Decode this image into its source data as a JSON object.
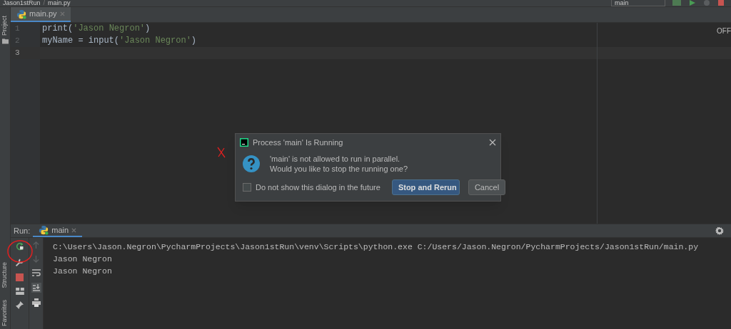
{
  "breadcrumb": {
    "items": [
      "Jason1stRun",
      "main.py"
    ],
    "separator": "/"
  },
  "run_config": {
    "label": "main"
  },
  "left_strip": {
    "top": [
      "Project"
    ],
    "bottom": [
      "Structure",
      "Favorites"
    ]
  },
  "editor_tabs": [
    {
      "label": "main.py",
      "selected": true
    }
  ],
  "editor": {
    "lines": [
      {
        "number": "1",
        "code": "print(**'Jason Negron'**)",
        "current": false
      },
      {
        "number": "2",
        "code": "myName = input(**'Jason Negron'**)",
        "current": false
      },
      {
        "number": "3",
        "current": true
      }
    ],
    "right_label": "OFF"
  },
  "dialog": {
    "title": "Process 'main' Is Running",
    "message": [
      "'main' is not allowed to run in parallel.",
      "Would you like to stop the running one?"
    ],
    "checkbox": {
      "label": "Do not show this dialog in the future",
      "checked": false
    },
    "buttons": [
      {
        "label": "Stop and Rerun",
        "default": true
      },
      {
        "label": "Cancel",
        "default": false
      }
    ]
  },
  "run_panel": {
    "title": "Run:",
    "tabs": [
      {
        "label": "main",
        "selected": true
      }
    ],
    "console": [
      "C:\\Users\\Jason.Negron\\PycharmProjects\\Jason1stRun\\venv\\Scripts\\python.exe C:/Users/Jason.Negron/PycharmProjects/Jason1stRun/main.py",
      "Jason Negron",
      "Jason Negron"
    ]
  }
}
